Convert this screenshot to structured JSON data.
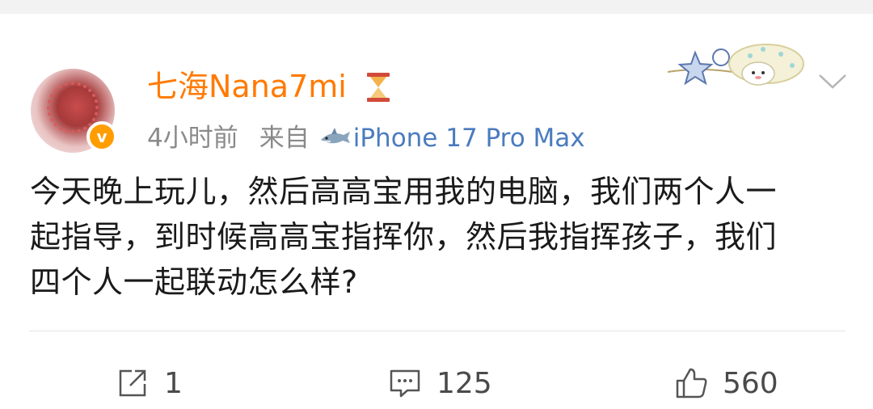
{
  "post": {
    "username": "七海Nana7mi",
    "user_badge_icon": "hourglass-icon",
    "verified_mark": "v",
    "time": "4小时前",
    "source_prefix": "来自",
    "source_icon": "shark-icon",
    "device": "iPhone 17 Pro Max",
    "content_lines": [
      "今天晚上玩儿，然后高高宝用我的电脑，我们两个人一",
      "起指导，到时候高高宝指挥你，然后我指挥孩子，我们",
      "四个人一起联动怎么样?"
    ]
  },
  "actions": {
    "repost_count": "1",
    "comment_count": "125",
    "like_count": "560"
  },
  "colors": {
    "username": "#ff7a00",
    "device_link": "#4a7bbf",
    "verified_badge": "#ff9d00",
    "meta_gray": "#8a8a8a"
  }
}
